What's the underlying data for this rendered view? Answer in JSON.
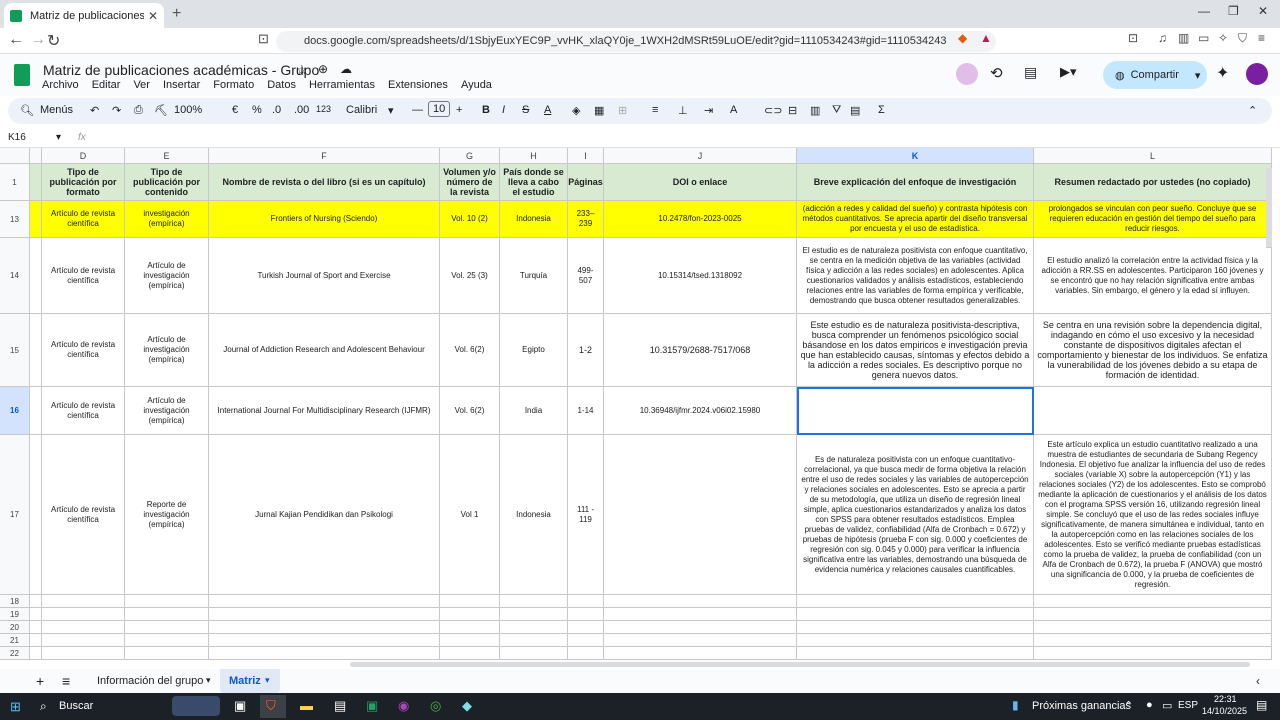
{
  "browser": {
    "tab_title": "Matriz de publicaciones académ",
    "url": "docs.google.com/spreadsheets/d/1SbjyEuxYEC9P_vvHK_xlaQY0je_1WXH2dMSRt59LuOE/edit?gid=1110534243#gid=1110534243"
  },
  "doc": {
    "title": "Matriz de publicaciones académicas - Grupo",
    "menus": [
      "Archivo",
      "Editar",
      "Ver",
      "Insertar",
      "Formato",
      "Datos",
      "Herramientas",
      "Extensiones",
      "Ayuda"
    ],
    "share": "Compartir"
  },
  "toolbar": {
    "menus": "Menús",
    "zoom": "100%",
    "currency": "€",
    "percent": "%",
    "dec_less": ".0",
    "dec_more": ".00",
    "num": "123",
    "font": "Calibri",
    "font_size": "10"
  },
  "formula": {
    "cell_ref": "K16",
    "fx": "fx"
  },
  "columns": [
    {
      "letter": "D",
      "header": "Tipo de publicación por formato"
    },
    {
      "letter": "E",
      "header": "Tipo de publicación por contenido"
    },
    {
      "letter": "F",
      "header": "Nombre de revista o del libro (si es un capítulo)"
    },
    {
      "letter": "G",
      "header": "Volumen y/o número de la revista"
    },
    {
      "letter": "H",
      "header": "País donde se lleva a cabo el estudio"
    },
    {
      "letter": "I",
      "header": "Páginas"
    },
    {
      "letter": "J",
      "header": "DOI o enlace"
    },
    {
      "letter": "K",
      "header": "Breve explicación del enfoque de investigación"
    },
    {
      "letter": "L",
      "header": "Resumen redactado por ustedes (no copiado)"
    }
  ],
  "rows": [
    {
      "num": "13",
      "cells": [
        "Artículo de revista científica",
        "investigación (empírica)",
        "Frontiers of Nursing (Sciendo)",
        "Vol. 10 (2)",
        "Indonesia",
        "233–239",
        "10.2478/fon-2023-0025",
        "(adicción a redes y calidad del sueño) y contrasta hipótesis con métodos cuantitativos. Se aprecia apartir del diseño transversal por encuesta y el uso de estadística.",
        "prolongados se vinculan con peor sueño. Concluye que se requieren educación en gestión del tiempo del sueño para reducir riesgos."
      ]
    },
    {
      "num": "14",
      "cells": [
        "Artículo de revista científica",
        "Artículo de investigación (empírica)",
        "Turkish Journal of Sport and Exercise",
        "Vol. 25 (3)",
        "Turquía",
        "499-507",
        "10.15314/tsed.1318092",
        "El estudio es de naturaleza positivista con enfoque cuantitativo, se centra en la medición objetiva de las variables (actividad física y adicción a las redes sociales) en adolescentes. Aplica cuestionarios validados y análisis estadísticos, estableciendo relaciones entre las variables de forma empírica y verificable, demostrando que busca obtener resultados generalizables.",
        "El estudio analizó la correlación entre la actividad física y la adicción a RR.SS en adolescentes. Participaron 160 jóvenes y se encontró que no hay relación significativa entre ambas variables. Sin embargo, el género y la edad sí influyen."
      ]
    },
    {
      "num": "15",
      "cells": [
        "Artículo de revista científica",
        "Artículo de investigación (empírica)",
        "Journal of Addiction Research and Adolescent Behaviour",
        "Vol. 6(2)",
        "Egipto",
        "1-2",
        "10.31579/2688-7517/068",
        "Este estudio es de naturaleza positivista-descriptiva, busca comprender un fenómenos psicológico social básandose en los datos empiricos e investigación previa que han establecido causas, síntomas y efectos debido a la adicción a redes sociales. Es descriptivo porque no genera nuevos datos.",
        "Se centra en una revisión sobre la dependencia digital, indagando en cómo el uso excesivo y la necesidad constante de dispositivos digitales afectan el comportamiento y bienestar de los individuos. Se enfatiza la vunerabilidad de los jóvenes debido a su etapa de formación de identidad."
      ]
    },
    {
      "num": "16",
      "cells": [
        "Artículo de revista científica",
        "Artículo de investigación (empírica)",
        "International Journal For Multidisciplinary Research (IJFMR)",
        "Vol. 6(2)",
        "India",
        "1-14",
        "10.36948/ijfmr.2024.v06i02.15980",
        "",
        ""
      ]
    },
    {
      "num": "17",
      "cells": [
        "Artículo de revista científica",
        "Reporte de investigación (empírica)",
        "Jurnal Kajian Pendidikan dan Psikologi",
        "Vol 1",
        "Indonesia",
        "111 - 119",
        "",
        "Es de naturaleza positivista con un enfoque cuantitativo-correlacional, ya que busca medir de forma objetiva la relación entre el uso de redes sociales y las variables de autopercepción y relaciones sociales en adolescentes. Esto se aprecia a partir de su metodología, que utiliza un diseño de regresión lineal simple, aplica cuestionarios estandarizados y analiza los datos con SPSS para obtener resultados estadísticos. Emplea pruebas de validez, confiabilidad (Alfa de Cronbach = 0.672) y pruebas de hipótesis (prueba F con sig. 0.000 y coeficientes de regresión con sig. 0.045 y 0.000) para verificar la influencia significativa entre las variables, demostrando una búsqueda de evidencia numérica y relaciones causales cuantificables.",
        "Este artículo explica un estudio cuantitativo realizado a una muestra de estudiantes de secundaria de Subang Regency Indonesia. El objetivo fue analizar la influencia del uso de redes sociales (variable X) sobre la autopercepción (Y1) y las relaciones sociales (Y2) de los adolescentes. Esto se comprobó mediante la aplicación de cuestionarios y el análisis de los datos con el programa SPSS versión 16, utilizando regresión lineal simple. Se concluyó que el uso de las redes sociales influye significativamente, de manera simultánea e individual, tanto en la autopercepción como en las relaciones sociales de los adolescentes. Esto se verificó mediante pruebas estadísticas como la prueba de validez, la prueba de confiabilidad (con un Alfa de Cronbach de 0.672), la prueba F (ANOVA) que mostró una significancia de 0.000, y la prueba de coeficientes de regresión."
      ]
    }
  ],
  "row1_num": "1",
  "empty_rows": [
    "18",
    "19",
    "20",
    "21",
    "22"
  ],
  "sheets": {
    "tab1": "Información del grupo",
    "tab2": "Matriz"
  },
  "taskbar": {
    "search": "Buscar",
    "news": "Próximas ganancias",
    "lang": "ESP",
    "time": "22:31",
    "date": "14/10/2025"
  }
}
